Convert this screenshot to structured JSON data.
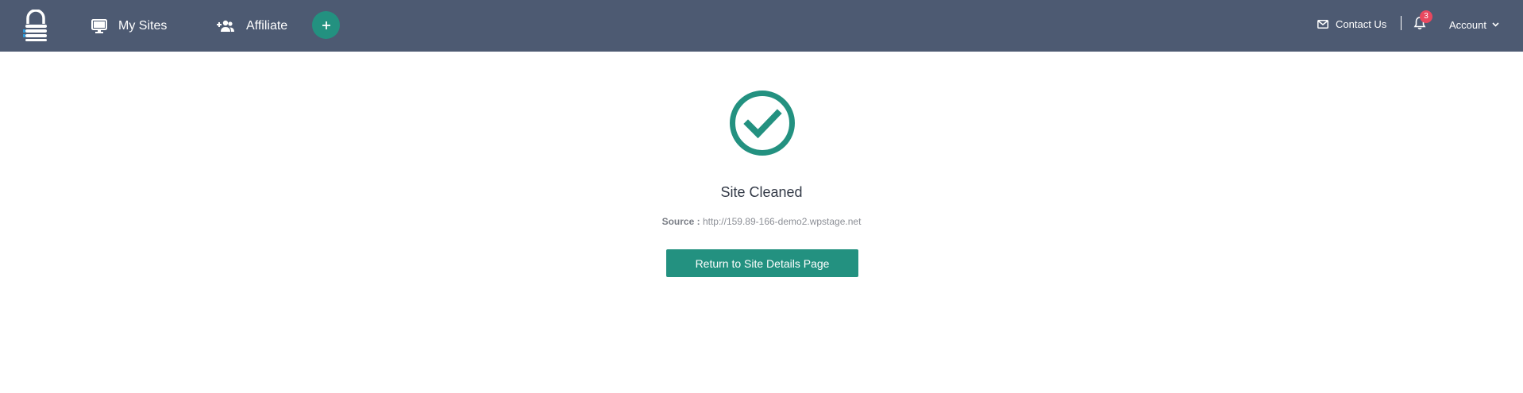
{
  "header": {
    "nav": {
      "my_sites_label": "My Sites",
      "affiliate_label": "Affiliate",
      "add_icon": "plus-icon"
    },
    "contact_label": "Contact Us",
    "notifications_count": "3",
    "account_label": "Account",
    "colors": {
      "bar": "#4d5a72",
      "accent": "#239180",
      "badge": "#e8485f"
    }
  },
  "main": {
    "status_icon": "check-circle-icon",
    "title": "Site Cleaned",
    "source_label": "Source :",
    "source_url": "http://159.89-166-demo2.wpstage.net",
    "return_button_label": "Return to Site Details Page"
  }
}
